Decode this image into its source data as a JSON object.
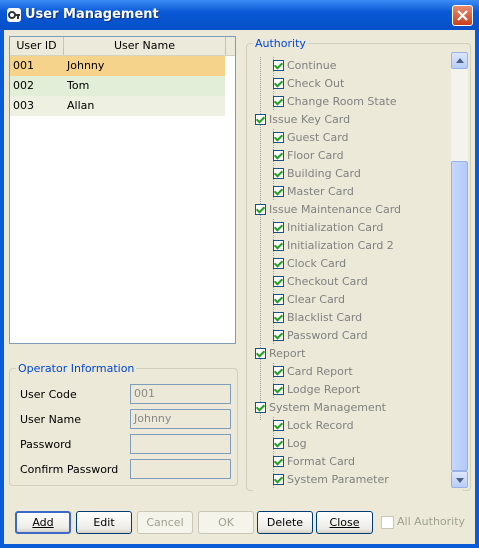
{
  "window": {
    "title": "User Management"
  },
  "user_list": {
    "columns": [
      "User ID",
      "User Name"
    ],
    "rows": [
      {
        "id": "001",
        "name": "Johnny",
        "selected": true
      },
      {
        "id": "002",
        "name": "Tom",
        "selected": false
      },
      {
        "id": "003",
        "name": "Allan",
        "selected": false
      }
    ]
  },
  "operator": {
    "title": "Operator Information",
    "user_code_label": "User Code",
    "user_code_value": "001",
    "user_name_label": "User Name",
    "user_name_value": "Johnny",
    "password_label": "Password",
    "password_value": "",
    "confirm_label": "Confirm Password",
    "confirm_value": ""
  },
  "authority": {
    "title": "Authority",
    "nodes": [
      {
        "level": 1,
        "label": "Continue",
        "checked": true
      },
      {
        "level": 1,
        "label": "Check Out",
        "checked": true
      },
      {
        "level": 1,
        "label": "Change Room State",
        "checked": true
      },
      {
        "level": 0,
        "label": "Issue Key Card",
        "checked": true
      },
      {
        "level": 1,
        "label": "Guest Card",
        "checked": true
      },
      {
        "level": 1,
        "label": "Floor Card",
        "checked": true
      },
      {
        "level": 1,
        "label": "Building Card",
        "checked": true
      },
      {
        "level": 1,
        "label": "Master Card",
        "checked": true
      },
      {
        "level": 0,
        "label": "Issue Maintenance Card",
        "checked": true
      },
      {
        "level": 1,
        "label": "Initialization Card",
        "checked": true
      },
      {
        "level": 1,
        "label": "Initialization Card 2",
        "checked": true
      },
      {
        "level": 1,
        "label": "Clock Card",
        "checked": true
      },
      {
        "level": 1,
        "label": "Checkout Card",
        "checked": true
      },
      {
        "level": 1,
        "label": "Clear Card",
        "checked": true
      },
      {
        "level": 1,
        "label": "Blacklist Card",
        "checked": true
      },
      {
        "level": 1,
        "label": "Password Card",
        "checked": true
      },
      {
        "level": 0,
        "label": "Report",
        "checked": true
      },
      {
        "level": 1,
        "label": "Card Report",
        "checked": true
      },
      {
        "level": 1,
        "label": "Lodge Report",
        "checked": true
      },
      {
        "level": 0,
        "label": "System Management",
        "checked": true
      },
      {
        "level": 1,
        "label": "Lock Record",
        "checked": true
      },
      {
        "level": 1,
        "label": "Log",
        "checked": true
      },
      {
        "level": 1,
        "label": "Format Card",
        "checked": true
      },
      {
        "level": 1,
        "label": "System Parameter",
        "checked": true
      }
    ]
  },
  "buttons": {
    "add": "Add",
    "edit": "Edit",
    "cancel": "Cancel",
    "ok": "OK",
    "delete": "Delete",
    "close": "Close"
  },
  "all_authority": {
    "label": "All Authority",
    "checked": false
  },
  "colors": {
    "title_bar": "#0a58d6",
    "dialog_bg": "#ece9d8",
    "selected_row": "#f5d38a",
    "row_alt": "#e2eed8",
    "group_title": "#0046d5"
  }
}
